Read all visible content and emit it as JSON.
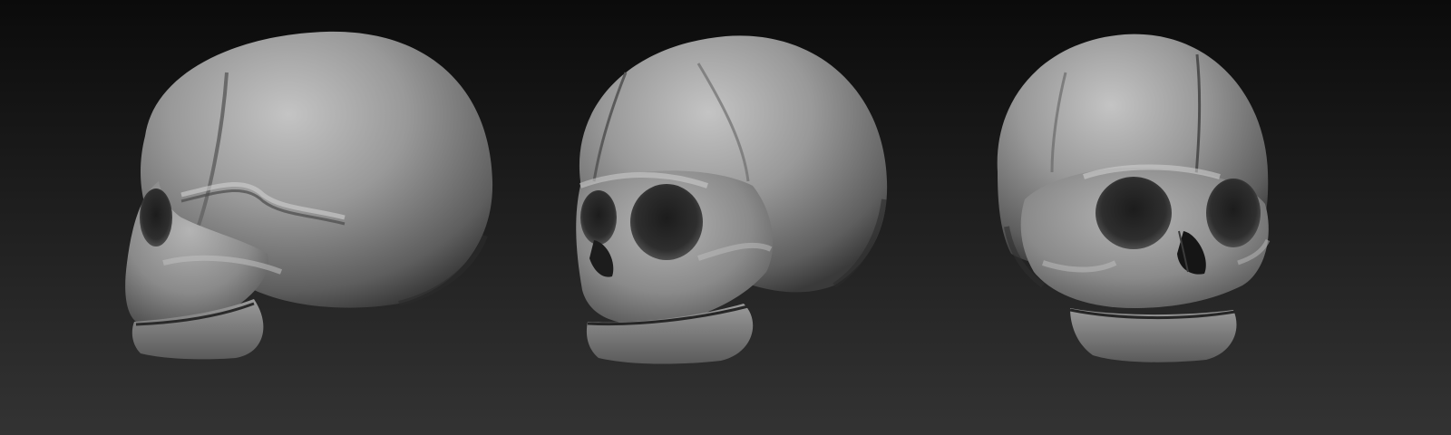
{
  "scene": {
    "background": {
      "top_color": "#0b0b0b",
      "bottom_color": "#333333"
    },
    "material": {
      "base_color": "#8f8f8f",
      "highlight_color": "#c8c8c8",
      "shadow_color": "#2a2a2a",
      "cavity_color": "#151515"
    },
    "models": [
      {
        "name": "skull",
        "view": "side"
      },
      {
        "name": "skull",
        "view": "three-quarter"
      },
      {
        "name": "skull",
        "view": "front"
      }
    ]
  }
}
